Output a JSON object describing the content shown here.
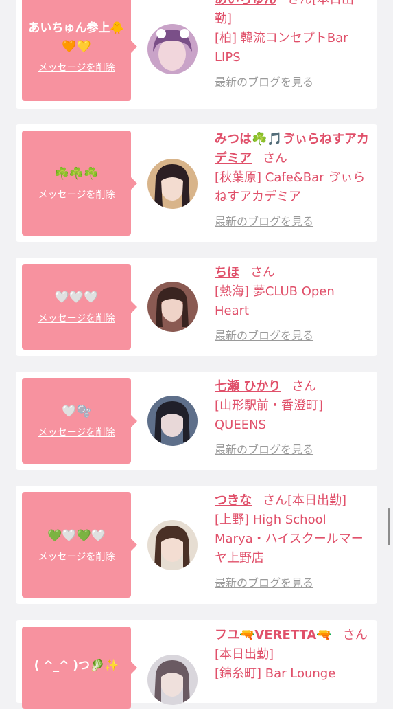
{
  "cards": [
    {
      "message": "あいちゅん参上🐥🧡💛",
      "delete_label": "メッセージを削除",
      "name": "あいちゅん",
      "suffix": "さん[本日出勤]",
      "shop": "[柏] 韓流コンセプトBar LIPS",
      "blog_link": "最新のブログを見る"
    },
    {
      "message": "☘️☘️☘️",
      "delete_label": "メッセージを削除",
      "name": "みつは☘️🎵ゔぃらねすアカデミア",
      "suffix": "さん",
      "shop": "[秋葉原] Cafe&Bar ゔぃらねすアカデミア",
      "blog_link": "最新のブログを見る"
    },
    {
      "message": "🤍🤍🤍",
      "delete_label": "メッセージを削除",
      "name": "ちほ",
      "suffix": "さん",
      "shop": "[熱海] 夢CLUB Open Heart",
      "blog_link": "最新のブログを見る"
    },
    {
      "message": "🤍🫧",
      "delete_label": "メッセージを削除",
      "name": "七瀬 ひかり",
      "suffix": "さん",
      "shop": "[山形駅前・香澄町] QUEENS",
      "blog_link": "最新のブログを見る"
    },
    {
      "message": "💚🤍💚🤍",
      "delete_label": "メッセージを削除",
      "name": "つきな",
      "suffix": "さん[本日出勤]",
      "shop": "[上野] High School Marya・ハイスクールマーヤ上野店",
      "blog_link": "最新のブログを見る"
    },
    {
      "message": "( ^_^ )つ🥬✨",
      "delete_label": "",
      "name": "フユ🔫VERETTA🔫",
      "suffix": "さん[本日出勤]",
      "shop": "[錦糸町] Bar Lounge",
      "blog_link": ""
    }
  ],
  "colors": {
    "accent_pink": "#f7929f",
    "name_pink": "#e0506a",
    "link_gray": "#9a9a9a"
  }
}
